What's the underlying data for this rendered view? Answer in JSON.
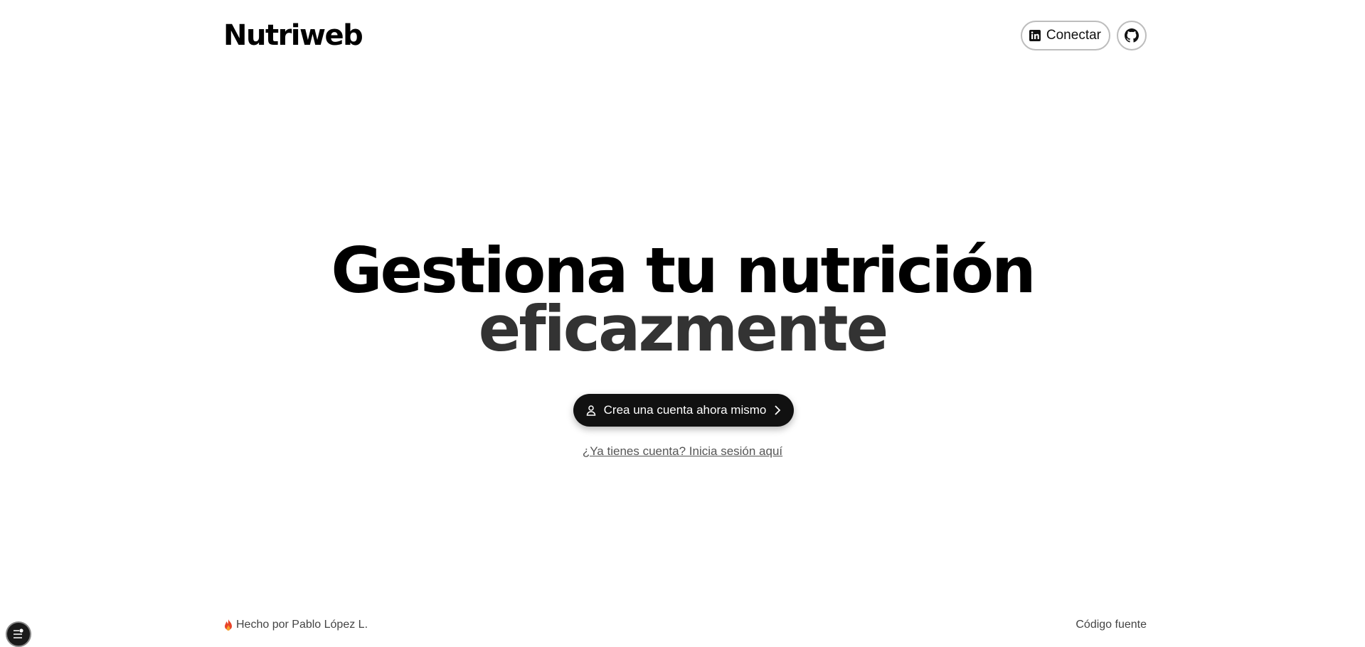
{
  "header": {
    "brand": "Nutriweb",
    "connect_label": "Conectar",
    "connect_icon": "linkedin-icon",
    "github_icon": "github-icon"
  },
  "hero": {
    "line1": "Gestiona tu nutrición",
    "line2": "eficazmente"
  },
  "cta": {
    "label": "Crea una cuenta ahora mismo",
    "icon": "user-icon",
    "trailing_icon": "chevron-right-icon"
  },
  "login_link": "¿Ya tienes cuenta? Inicia sesión aquí",
  "footer": {
    "made_by": "Hecho por Pablo López L.",
    "made_by_icon": "fire-icon",
    "source_code": "Código fuente"
  },
  "floating_button_icon": "settings-sliders-icon",
  "colors": {
    "background": "#ffffff",
    "primary": "#111111",
    "hero_secondary": "#333333",
    "muted_text": "#555555",
    "fire": "#e8432a"
  }
}
